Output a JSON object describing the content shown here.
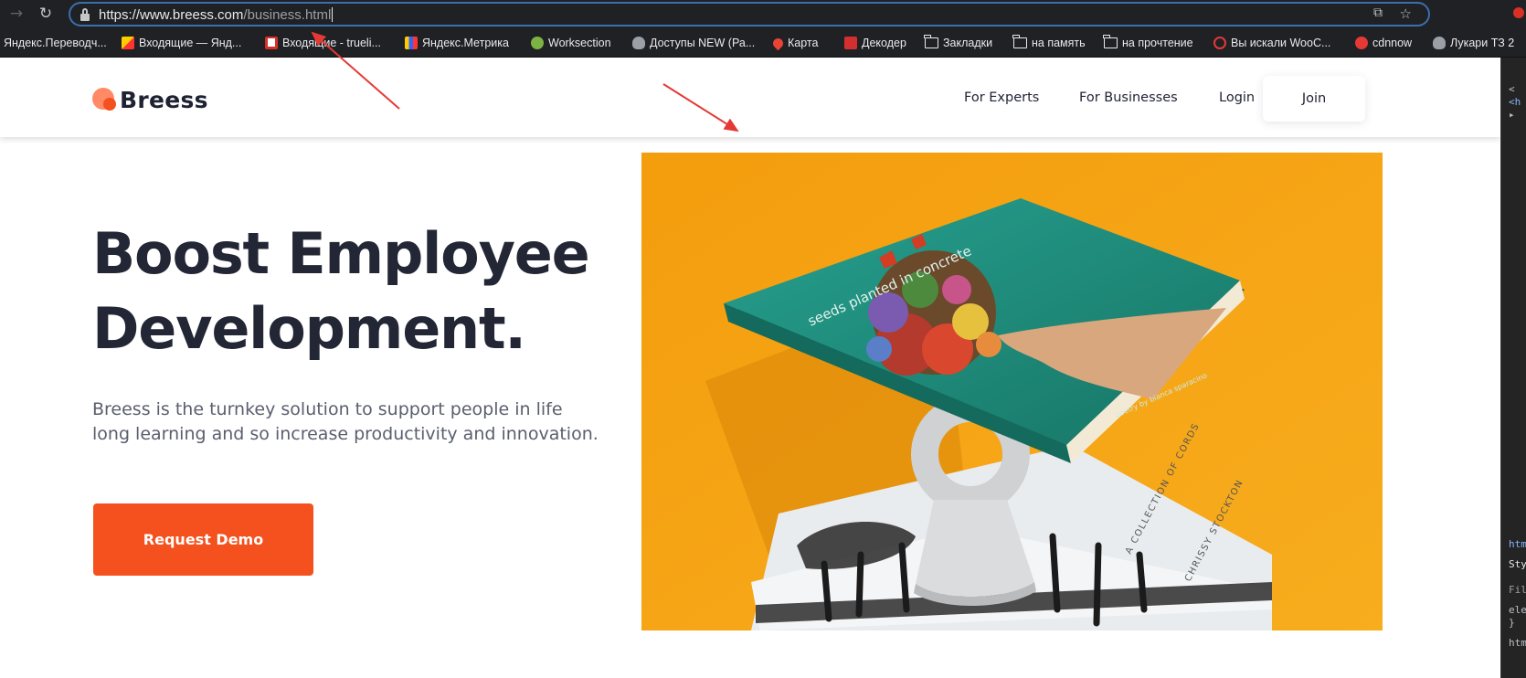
{
  "browser": {
    "url_prefix": "https://",
    "url_domain": "www.breess.com",
    "url_path": "/business.html",
    "icons": {
      "back": "arrow-right-icon",
      "reload": "reload-icon",
      "lock": "lock-icon",
      "cast": "cast-icon",
      "star": "star-icon"
    }
  },
  "bookmarks": [
    {
      "label": "Яндекс.Переводч...",
      "icon": "none"
    },
    {
      "label": "Входящие — Янд...",
      "icon": "gmail"
    },
    {
      "label": "Входящие - trueli...",
      "icon": "gmail"
    },
    {
      "label": "Яндекс.Метрика",
      "icon": "metrika"
    },
    {
      "label": "Worksection",
      "icon": "worksection"
    },
    {
      "label": "Доступы NEW (Ра...",
      "icon": "apple"
    },
    {
      "label": "Карта",
      "icon": "map-pin"
    },
    {
      "label": "Декодер",
      "icon": "decoder"
    },
    {
      "label": "Закладки",
      "icon": "folder"
    },
    {
      "label": "на память",
      "icon": "folder"
    },
    {
      "label": "на прочтение",
      "icon": "folder"
    },
    {
      "label": "Вы искали WooC...",
      "icon": "link"
    },
    {
      "label": "cdnnow",
      "icon": "cdnnow"
    },
    {
      "label": "Лукари ТЗ 2",
      "icon": "apple"
    }
  ],
  "site": {
    "logo_text": "Breess",
    "nav": {
      "experts": "For Experts",
      "businesses": "For Businesses",
      "login": "Login",
      "join": "Join"
    },
    "hero": {
      "title_accent": "Boost",
      "title_rest_line1": " Employee",
      "title_line2": "Development.",
      "subtitle": "Breess is the turnkey solution to support people in life long learning and so increase productivity and innovation.",
      "cta": "Request Demo"
    },
    "image": {
      "book_title": "seeds planted in concrete",
      "book_author": "poetry by bianca sparacino",
      "lower_book_1": "A COLLECTION OF CORDS",
      "lower_book_2": "CHRISSY STOCKTON"
    }
  },
  "devtools": {
    "lines": [
      "<",
      "<h",
      "▸",
      "htm",
      "Sty",
      "Filt",
      "ele",
      "}",
      "htm"
    ]
  },
  "colors": {
    "brand_orange": "#f4511e",
    "accent_underline": "#ff7a59",
    "heading": "#232634",
    "image_bg": "#f6a313",
    "book_teal": "#1f8c7e",
    "omnibox_focus": "#3c6fae",
    "annotation_arrow": "#e53935"
  }
}
